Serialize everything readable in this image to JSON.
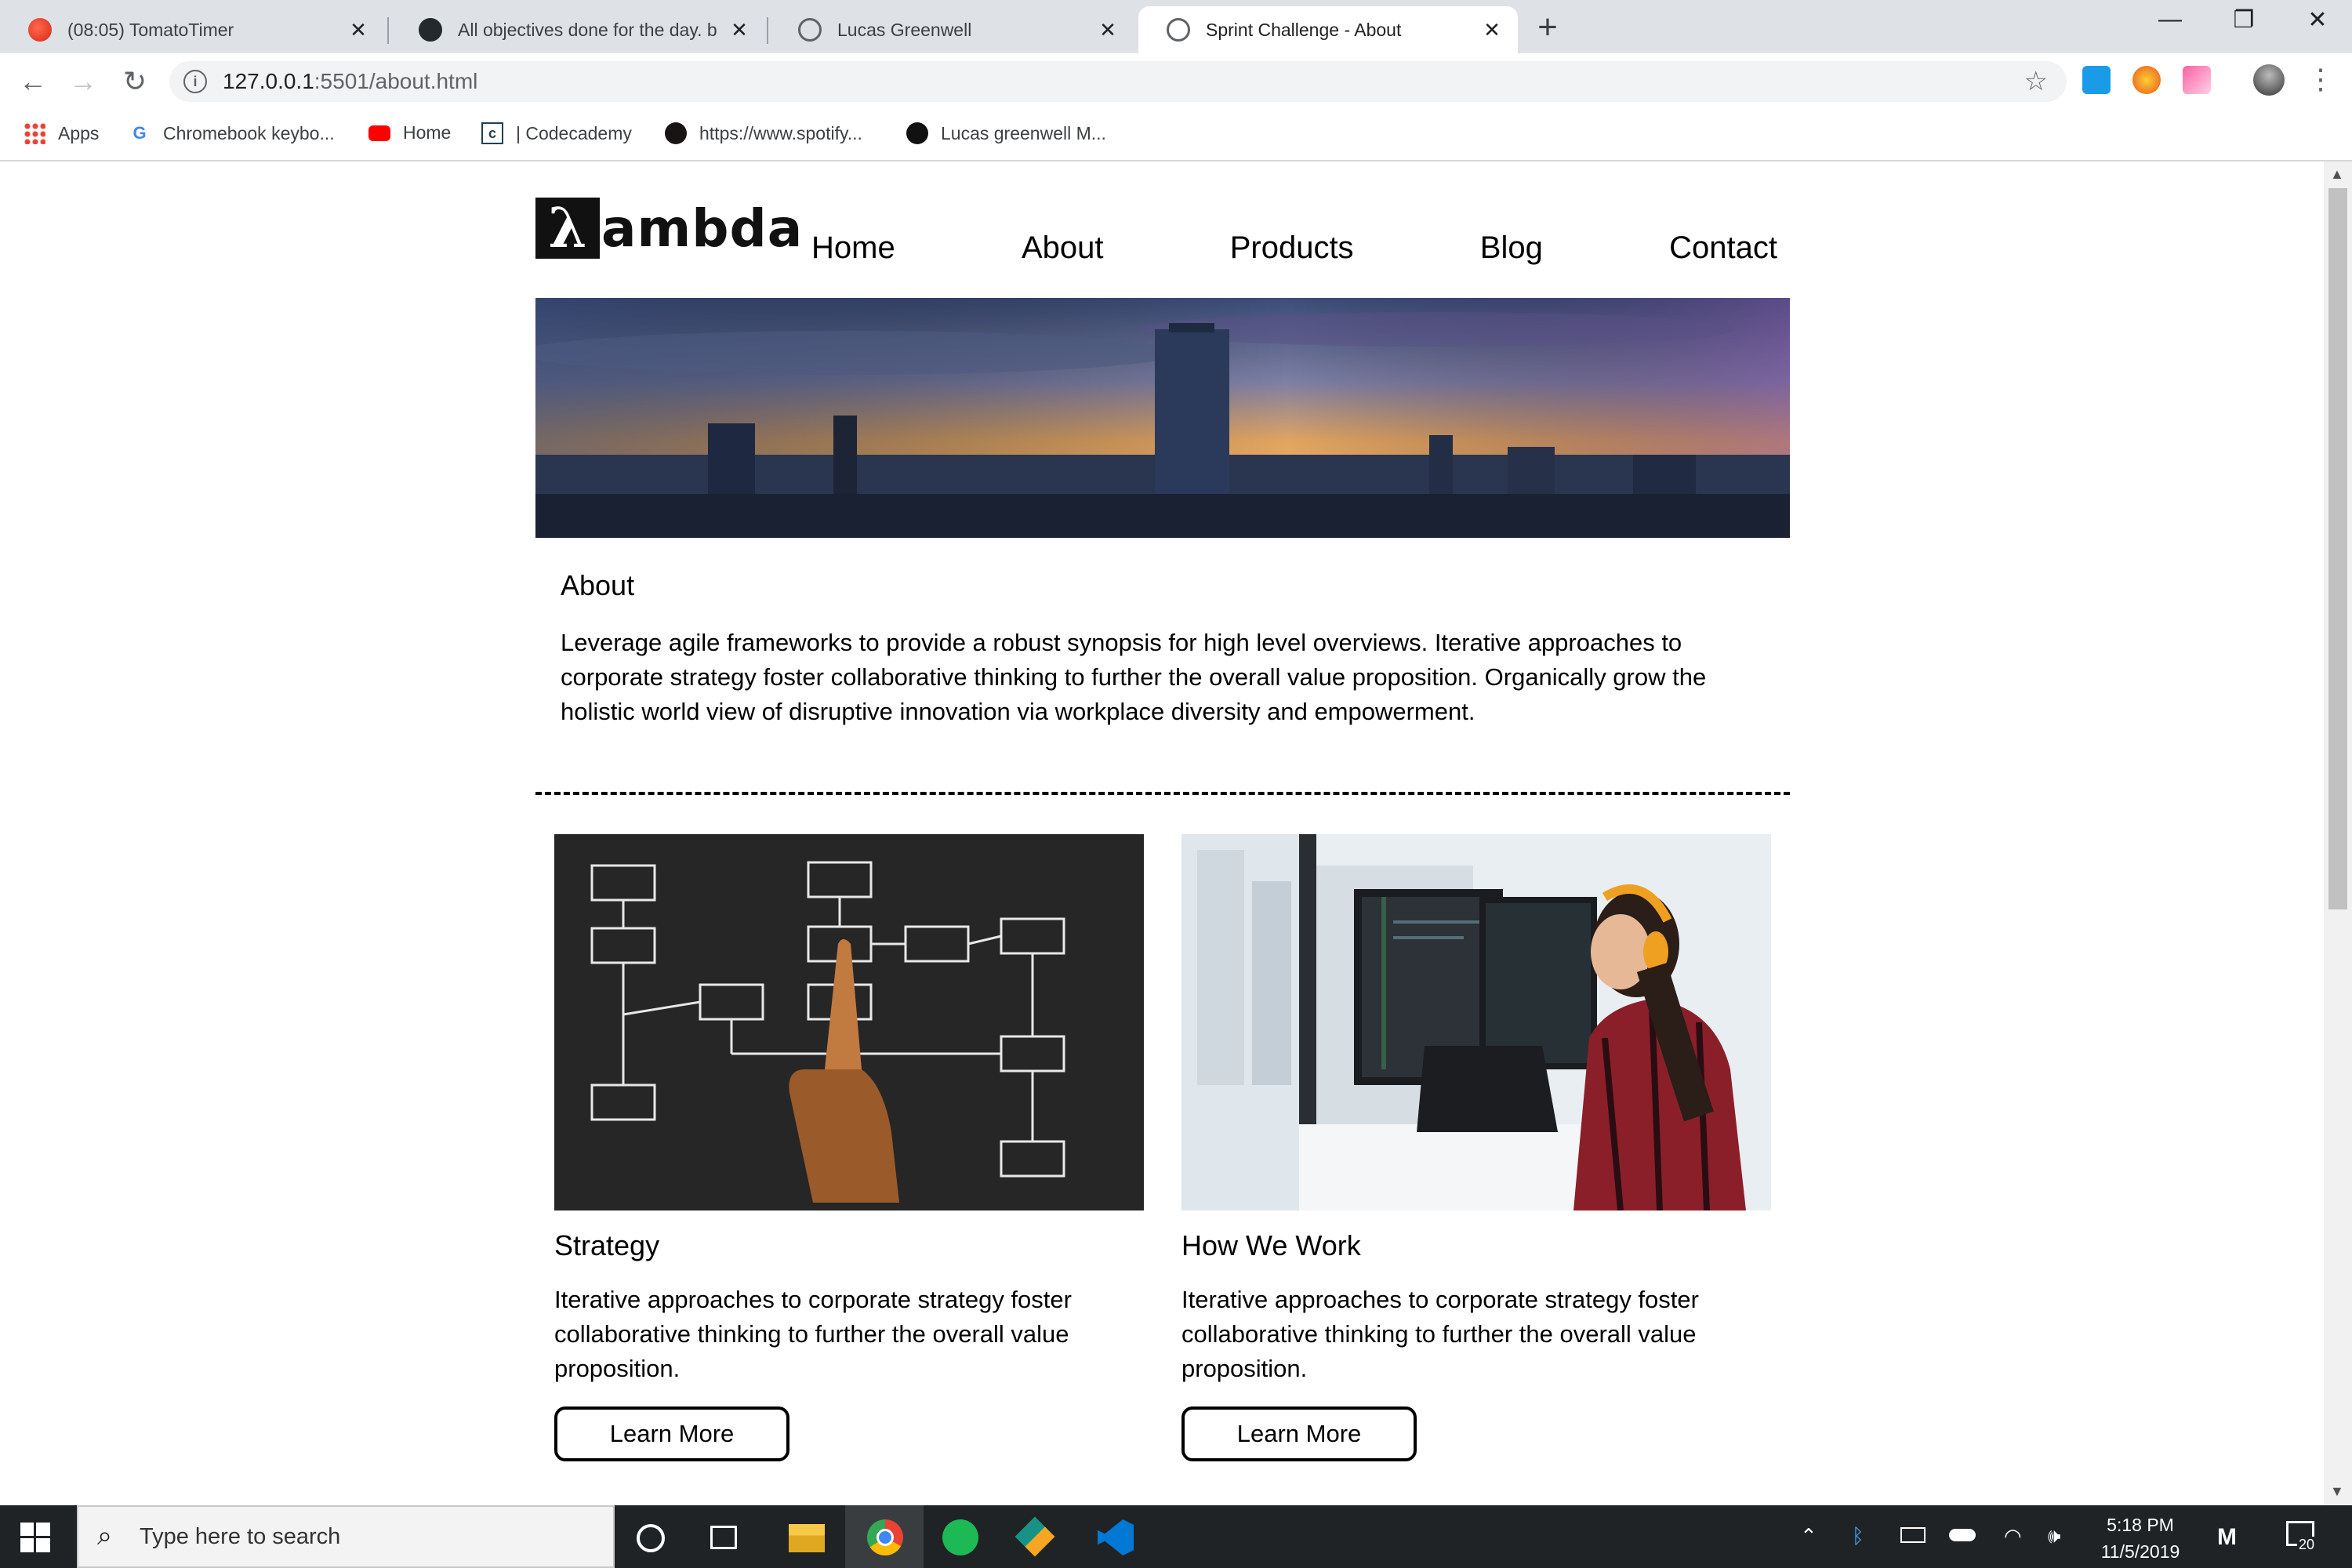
{
  "browser": {
    "tabs": [
      {
        "title": "(08:05) TomatoTimer",
        "icon": "tomato-icon"
      },
      {
        "title": "All objectives done for the day. b",
        "icon": "github-icon"
      },
      {
        "title": "Lucas Greenwell",
        "icon": "globe-icon"
      },
      {
        "title": "Sprint Challenge - About",
        "icon": "globe-icon",
        "active": true
      }
    ],
    "tab_close": "✕",
    "new_tab": "+",
    "window_controls": {
      "minimize": "—",
      "restore": "❐",
      "close": "✕"
    },
    "nav": {
      "back": "←",
      "forward": "→",
      "reload": "↻"
    },
    "url": {
      "host": "127.0.0.1",
      "rest": ":5501/about.html"
    },
    "star": "☆",
    "menu": "⋮",
    "bookmarks": [
      {
        "label": "Apps",
        "icon": "apps-grid-icon"
      },
      {
        "label": "Chromebook keybo...",
        "icon": "google-icon",
        "glyph": "G"
      },
      {
        "label": "Home",
        "icon": "youtube-icon"
      },
      {
        "label": "| Codecademy",
        "icon": "codecademy-icon",
        "glyph": "c"
      },
      {
        "label": "https://www.spotify...",
        "icon": "spotify-icon"
      },
      {
        "label": "Lucas greenwell M...",
        "icon": "github-icon"
      }
    ]
  },
  "site": {
    "logo": {
      "lambda": "λ",
      "word": "ambda"
    },
    "nav": [
      "Home",
      "About",
      "Products",
      "Blog",
      "Contact"
    ],
    "about": {
      "heading": "About",
      "text": "Leverage agile frameworks to provide a robust synopsis for high level overviews. Iterative approaches to corporate strategy foster collaborative thinking to further the overall value proposition. Organically grow the holistic world view of disruptive innovation via workplace diversity and empowerment."
    },
    "cards": [
      {
        "heading": "Strategy",
        "text": "Iterative approaches to corporate strategy foster collaborative thinking to further the overall value proposition.",
        "button": "Learn More"
      },
      {
        "heading": "How We Work",
        "text": "Iterative approaches to corporate strategy foster collaborative thinking to further the overall value proposition.",
        "button": "Learn More"
      }
    ]
  },
  "taskbar": {
    "search_placeholder": "Type here to search",
    "time": "5:18 PM",
    "date": "11/5/2019",
    "notifications": "20",
    "apps": [
      "cortana-icon",
      "task-view-icon",
      "file-explorer-icon",
      "chrome-icon",
      "spotify-icon",
      "gitkraken-icon",
      "vscode-icon"
    ]
  },
  "colors": {
    "tabstrip": "#dee1e6",
    "taskbar": "#202325",
    "text": "#000000"
  }
}
